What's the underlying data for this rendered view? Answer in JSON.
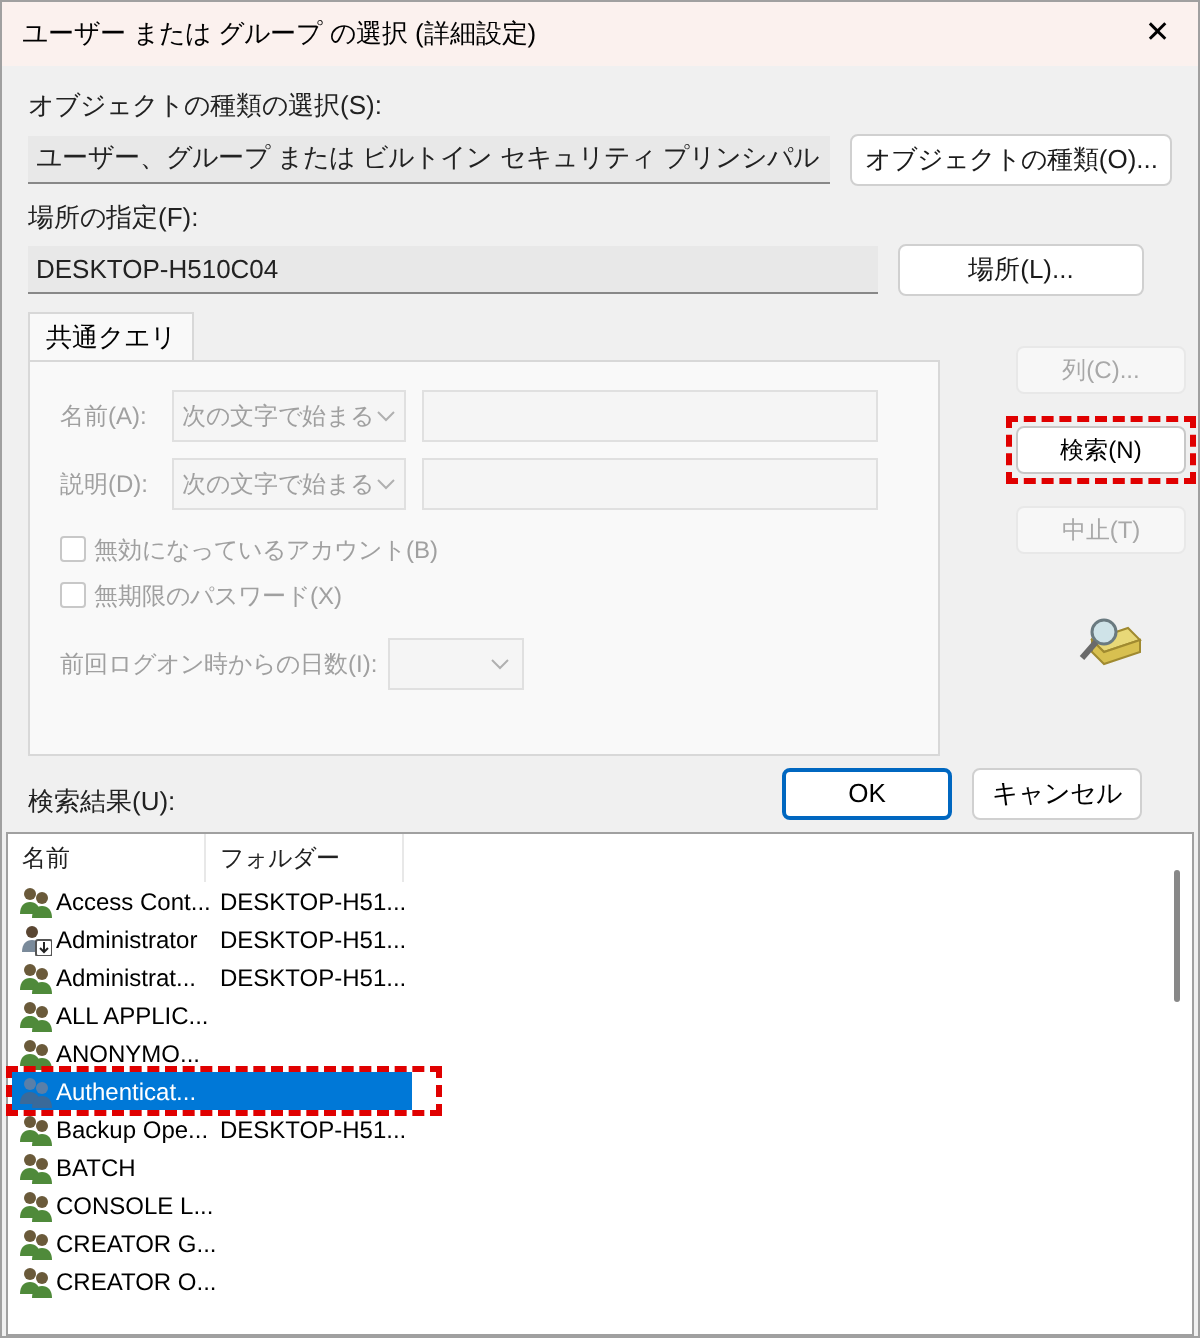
{
  "window": {
    "title": "ユーザー または グループ の選択 (詳細設定)",
    "close": "✕"
  },
  "object_type": {
    "label": "オブジェクトの種類の選択(S):",
    "value": "ユーザー、グループ または ビルトイン セキュリティ プリンシパル",
    "button": "オブジェクトの種類(O)..."
  },
  "location": {
    "label": "場所の指定(F):",
    "value": "DESKTOP-H510C04",
    "button": "場所(L)..."
  },
  "tabs": [
    {
      "label": "共通クエリ",
      "selected": true
    }
  ],
  "query": {
    "name_label": "名前(A):",
    "name_mode": "次の文字で始まる",
    "desc_label": "説明(D):",
    "desc_mode": "次の文字で始まる",
    "checkboxes": [
      {
        "label": "無効になっているアカウント(B)",
        "checked": false,
        "disabled": true
      },
      {
        "label": "無期限のパスワード(X)",
        "checked": false,
        "disabled": true
      }
    ],
    "days_label": "前回ログオン時からの日数(I):"
  },
  "side_buttons": [
    {
      "label": "列(C)...",
      "disabled": true,
      "annotated": false
    },
    {
      "label": "検索(N)",
      "disabled": false,
      "annotated": true
    },
    {
      "label": "中止(T)",
      "disabled": true,
      "annotated": false
    }
  ],
  "buttons": [
    {
      "label": "OK",
      "kind": "primary"
    },
    {
      "label": "キャンセル",
      "kind": "normal"
    }
  ],
  "results": {
    "label": "検索結果(U):",
    "columns": [
      "名前",
      "フォルダー"
    ],
    "rows": [
      {
        "kind": "group",
        "name": "Access Cont...",
        "folder": "DESKTOP-H51...",
        "selected": false,
        "annotated": false
      },
      {
        "kind": "user",
        "name": "Administrator",
        "folder": "DESKTOP-H51...",
        "selected": false,
        "annotated": false
      },
      {
        "kind": "group",
        "name": "Administrat...",
        "folder": "DESKTOP-H51...",
        "selected": false,
        "annotated": false
      },
      {
        "kind": "group",
        "name": "ALL APPLIC...",
        "selected": false,
        "annotated": false
      },
      {
        "kind": "group",
        "name": "ANONYMO...",
        "selected": false,
        "annotated": false
      },
      {
        "kind": "group",
        "name": "Authenticat...",
        "selected": true,
        "annotated": true
      },
      {
        "kind": "group",
        "name": "Backup Ope...",
        "folder": "DESKTOP-H51...",
        "selected": false,
        "annotated": false
      },
      {
        "kind": "group",
        "name": "BATCH",
        "selected": false,
        "annotated": false
      },
      {
        "kind": "group",
        "name": "CONSOLE L...",
        "selected": false,
        "annotated": false
      },
      {
        "kind": "group",
        "name": "CREATOR G...",
        "selected": false,
        "annotated": false
      },
      {
        "kind": "group",
        "name": "CREATOR O...",
        "selected": false,
        "annotated": false
      }
    ]
  }
}
